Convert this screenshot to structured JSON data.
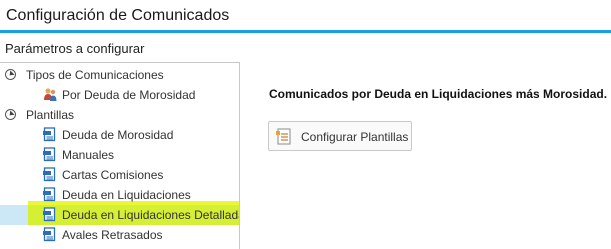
{
  "window": {
    "title": "Configuración de Comunicados"
  },
  "params_label": "Parámetros a configurar",
  "tree": {
    "groups": [
      {
        "label": "Tipos de Comunicaciones",
        "items": [
          {
            "label": "Por Deuda de Morosidad",
            "icon": "people-icon"
          }
        ]
      },
      {
        "label": "Plantillas",
        "items": [
          {
            "label": "Deuda de Morosidad",
            "icon": "document-template-icon"
          },
          {
            "label": "Manuales",
            "icon": "document-template-icon"
          },
          {
            "label": "Cartas Comisiones",
            "icon": "document-template-icon"
          },
          {
            "label": "Deuda en Liquidaciones",
            "icon": "document-template-icon"
          },
          {
            "label": "Deuda en Liquidaciones Detallada",
            "icon": "document-template-icon",
            "selected": true
          },
          {
            "label": "Avales Retrasados",
            "icon": "document-template-icon"
          }
        ]
      }
    ]
  },
  "main": {
    "heading": "Comunicados por Deuda en Liquidaciones más Morosidad.",
    "configure_button": "Configurar Plantillas"
  },
  "colors": {
    "accent": "#1ba1e2",
    "selection": "#cce8f6",
    "highlight": "#d4ef34"
  }
}
